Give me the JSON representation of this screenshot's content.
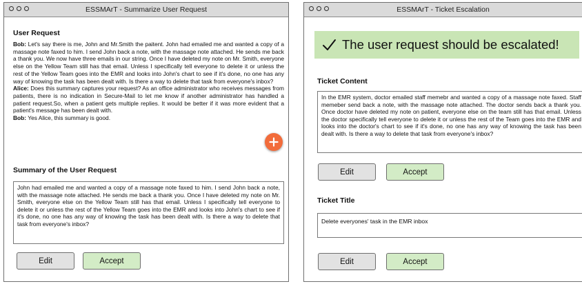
{
  "left_window": {
    "title": "ESSMArT - Summarize User Request",
    "user_request_heading": "User Request",
    "conversation": {
      "bob_label": "Bob:",
      "bob_text": " Let's say there is me, John and Mr.Smith the paitent. John had emailed me and wanted a copy of a massage note faxed to him. I send John back a note, with the massage note attached. He sends me back a thank you. We now have three emails in our string. Once I have deleted my note on Mr. Smith, everyone else on the Yellow Team still has that email. Unless I specifically tell everyone to delete it or unless the rest of the Yellow Team goes into the EMR and looks into John's chart to see if it's done, no one has any way of knowing the task has been dealt with. Is there a way to delete that task from everyone's inbox?",
      "alice_label": "Alice:",
      "alice_text": " Does this summary captures your request? As an office administrator who receives messages from patients, there is no indication in Secure-Mail to let me know if another administrator has handled a patient request.So, when a patient gets multiple replies. It would be better if it was more evident that a patient's message has been dealt with.",
      "bob2_label": "Bob:",
      "bob2_text": " Yes Alice, this summary is good."
    },
    "fab_icon": "plus-icon",
    "summary_heading": "Summary of the User Request",
    "summary_text": "John had emailed me and wanted a copy of a massage note  faxed to him. I send John back a note, with the massage note attached.  He sends me back a thank you. Once I have deleted my note on Mr. Smith, everyone else on the Yellow  Team still has that email. Unless I specifically tell everyone to delete  it or unless the rest of the Yellow Team goes into the EMR and looks into John's chart to see if it's done, no one has any way of knowing the  task has been dealt with. Is there a way to delete that task from  everyone's inbox?",
    "edit_label": "Edit",
    "accept_label": "Accept"
  },
  "right_window": {
    "title": "ESSMArT - Ticket Escalation",
    "banner_text": "The user request should be escalated!",
    "ticket_content_heading": "Ticket Content",
    "ticket_content_text": "In the EMR system, doctor emailed staff memebr and wanted a copy of a massage note faxed. Staff memeber send back a note, with the massage note attached. The doctor sends back a thank you. Once doctor have deleted my note on patient, everyone else on the team still has that email. Unless the doctor specifically tell everyone to delete it or unless the rest of the Team goes into the EMR and looks into the doctor's chart to see if it's done, no one has any way of knowing the  task has been dealt with. Is there a way to delete that task from  everyone's inbox?",
    "edit_label": "Edit",
    "accept_label": "Accept",
    "ticket_title_heading": "Ticket Title",
    "ticket_title_value": "Delete everyones' task in the EMR inbox",
    "edit_label_2": "Edit",
    "accept_label_2": "Accept"
  },
  "colors": {
    "accent_orange": "#f26c3b",
    "accept_green": "#d3ecc6",
    "banner_green": "#c9e5b5",
    "titlebar_gray": "#dadada"
  }
}
